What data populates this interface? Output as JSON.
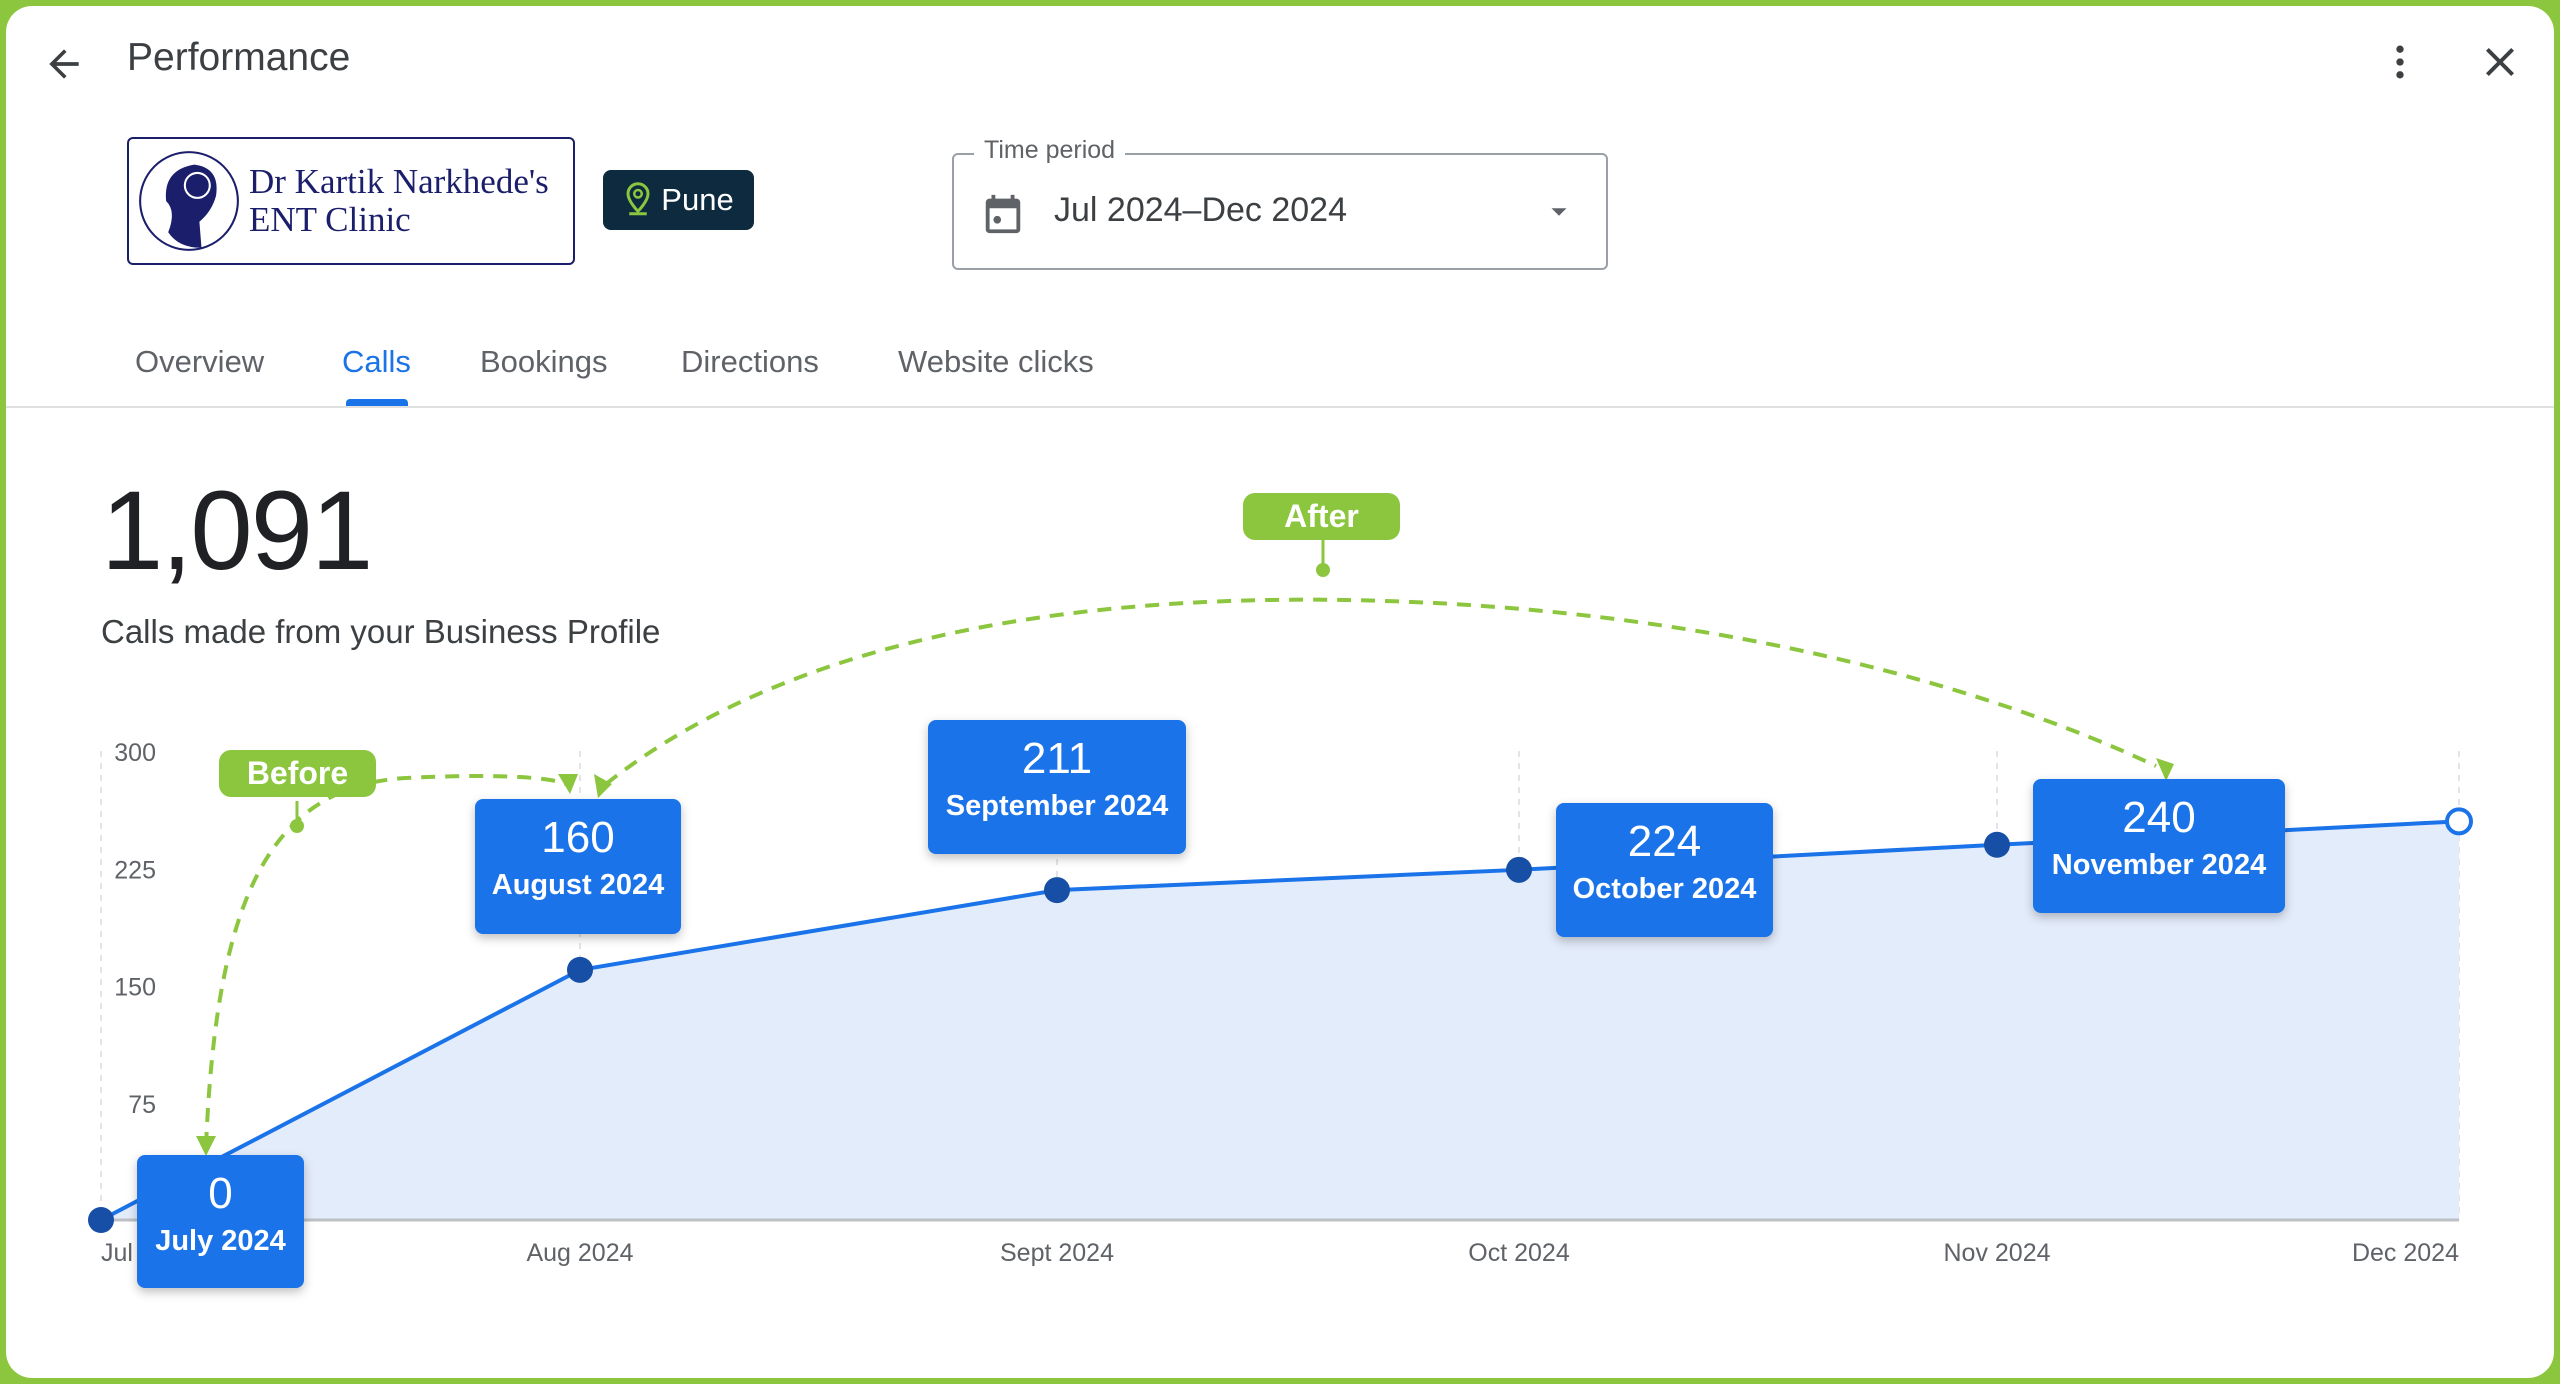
{
  "header": {
    "title": "Performance",
    "back_icon": "arrow-left-icon",
    "more_icon": "more-vert-icon",
    "close_icon": "close-icon"
  },
  "business": {
    "name_line1": "Dr Kartik Narkhede's",
    "name_line2": "ENT Clinic",
    "location": "Pune"
  },
  "time_period": {
    "label": "Time period",
    "value": "Jul 2024–Dec 2024"
  },
  "tabs": [
    {
      "label": "Overview"
    },
    {
      "label": "Calls",
      "active": true
    },
    {
      "label": "Bookings"
    },
    {
      "label": "Directions"
    },
    {
      "label": "Website clicks"
    }
  ],
  "summary": {
    "total": "1,091",
    "caption": "Calls made from your Business Profile"
  },
  "annotations": {
    "before": "Before",
    "after": "After"
  },
  "colors": {
    "accent": "#1a73e8",
    "highlight": "#8cc63f",
    "area": "#e3ecfb"
  },
  "chart_data": {
    "type": "area",
    "x": [
      "Jul",
      "Aug 2024",
      "Sept 2024",
      "Oct 2024",
      "Nov 2024",
      "Dec 2024"
    ],
    "values": [
      0,
      160,
      211,
      224,
      240,
      255
    ],
    "yticks": [
      "300",
      "225",
      "150",
      "75"
    ],
    "ylim": [
      0,
      300
    ],
    "grid": "vertical dashed",
    "data_labels": [
      {
        "value": "0",
        "label": "July 2024"
      },
      {
        "value": "160",
        "label": "August 2024"
      },
      {
        "value": "211",
        "label": "September 2024"
      },
      {
        "value": "224",
        "label": "October 2024"
      },
      {
        "value": "240",
        "label": "November 2024"
      }
    ]
  }
}
